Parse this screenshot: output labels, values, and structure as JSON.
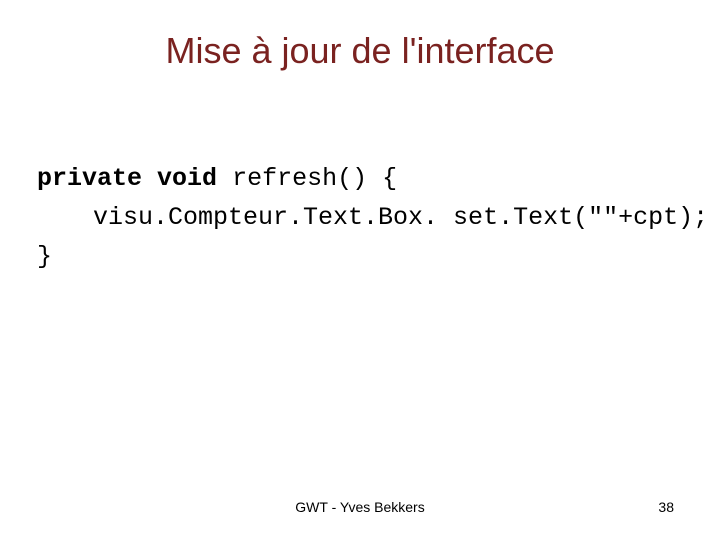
{
  "title": "Mise à jour de l'interface",
  "code": {
    "kw_private": "private",
    "kw_void": "void",
    "sig": " refresh() {",
    "body": "visu.Compteur.Text.Box. set.Text(\"\"+cpt);",
    "close": "}"
  },
  "footer": {
    "center": "GWT - Yves Bekkers",
    "page": "38"
  }
}
